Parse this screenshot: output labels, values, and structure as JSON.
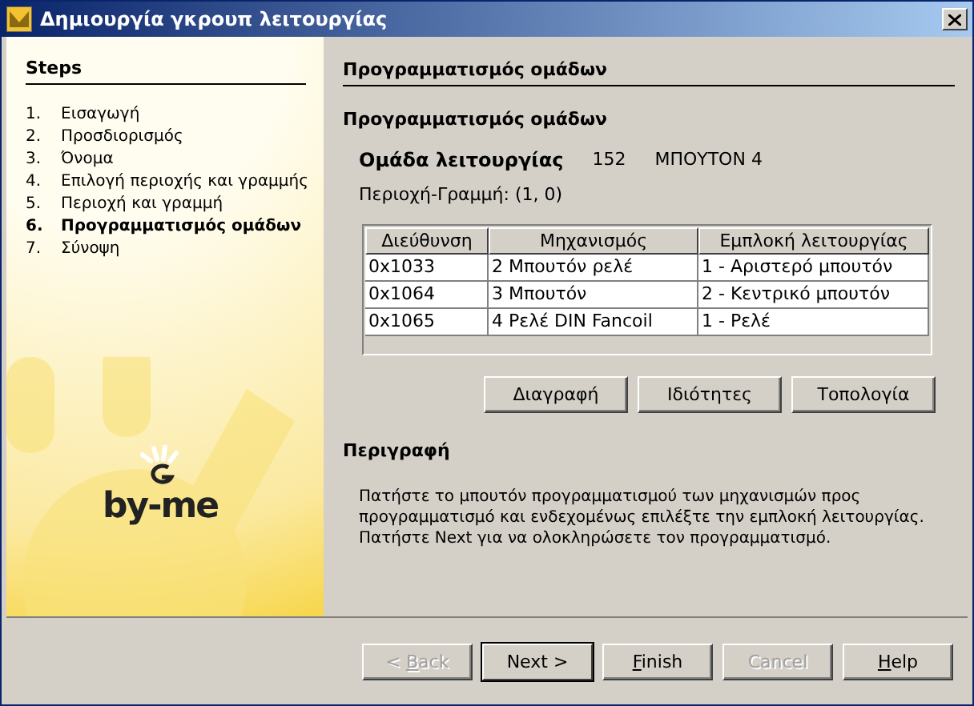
{
  "window": {
    "title": "Δημιουργία γκρουπ λειτουργίας"
  },
  "steps": {
    "title": "Steps",
    "items": [
      {
        "number": "1.",
        "label": "Εισαγωγή",
        "selected": false
      },
      {
        "number": "2.",
        "label": "Προσδιορισμός",
        "selected": false
      },
      {
        "number": "3.",
        "label": "Όνομα",
        "selected": false
      },
      {
        "number": "4.",
        "label": "Επιλογή περιοχής και γραμμής",
        "selected": false
      },
      {
        "number": "5.",
        "label": "Περιοχή και γραμμή",
        "selected": false
      },
      {
        "number": "6.",
        "label": "Προγραμματισμός ομάδων",
        "selected": true
      },
      {
        "number": "7.",
        "label": "Σύνοψη",
        "selected": false
      }
    ]
  },
  "logo": {
    "text": "by-me"
  },
  "panel": {
    "header": "Προγραμματισμός ομάδων",
    "subtitle": "Προγραμματισμός ομάδων",
    "group": {
      "label": "Ομάδα λειτουργίας",
      "number": "152",
      "name": "ΜΠΟΥΤΟΝ 4"
    },
    "area_line": "Περιοχή-Γραμμή: (1, 0)",
    "table": {
      "columns": [
        "Διεύθυνση",
        "Μηχανισμός",
        "Εμπλοκή λειτουργίας"
      ],
      "rows": [
        [
          "0x1033",
          "2 Μπουτόν ρελέ",
          "1 - Αριστερό μπουτόν"
        ],
        [
          "0x1064",
          "3 Μπουτόν",
          "2 - Κεντρικό μπουτόν"
        ],
        [
          "0x1065",
          "4 Ρελέ DIN Fancoil",
          "1 - Ρελέ"
        ]
      ]
    },
    "actions": [
      "Διαγραφή",
      "Ιδιότητες",
      "Τοπολογία"
    ],
    "description_title": "Περιγραφή",
    "description": "Πατήστε το μπουτόν προγραμματισμού των μηχανισμών προς προγραμματισμό και ενδεχομένως επιλέξτε την εμπλοκή λειτουργίας. Πατήστε Next για να ολοκληρώσετε τον προγραμματισμό."
  },
  "buttons": [
    {
      "label": [
        {
          "text": "< ",
          "underlined": false
        },
        {
          "text": "B",
          "underlined": true
        },
        {
          "text": "ack",
          "underlined": false
        }
      ],
      "disabled": true,
      "default": false
    },
    {
      "label": [
        {
          "text": "Next >",
          "underlined": false
        }
      ],
      "disabled": false,
      "default": true
    },
    {
      "label": [
        {
          "text": "F",
          "underlined": true
        },
        {
          "text": "inish",
          "underlined": false
        }
      ],
      "disabled": false,
      "default": false
    },
    {
      "label": [
        {
          "text": "Cancel",
          "underlined": false
        }
      ],
      "disabled": true,
      "default": false
    },
    {
      "label": [
        {
          "text": "H",
          "underlined": true
        },
        {
          "text": "elp",
          "underlined": false
        }
      ],
      "disabled": false,
      "default": false
    }
  ]
}
